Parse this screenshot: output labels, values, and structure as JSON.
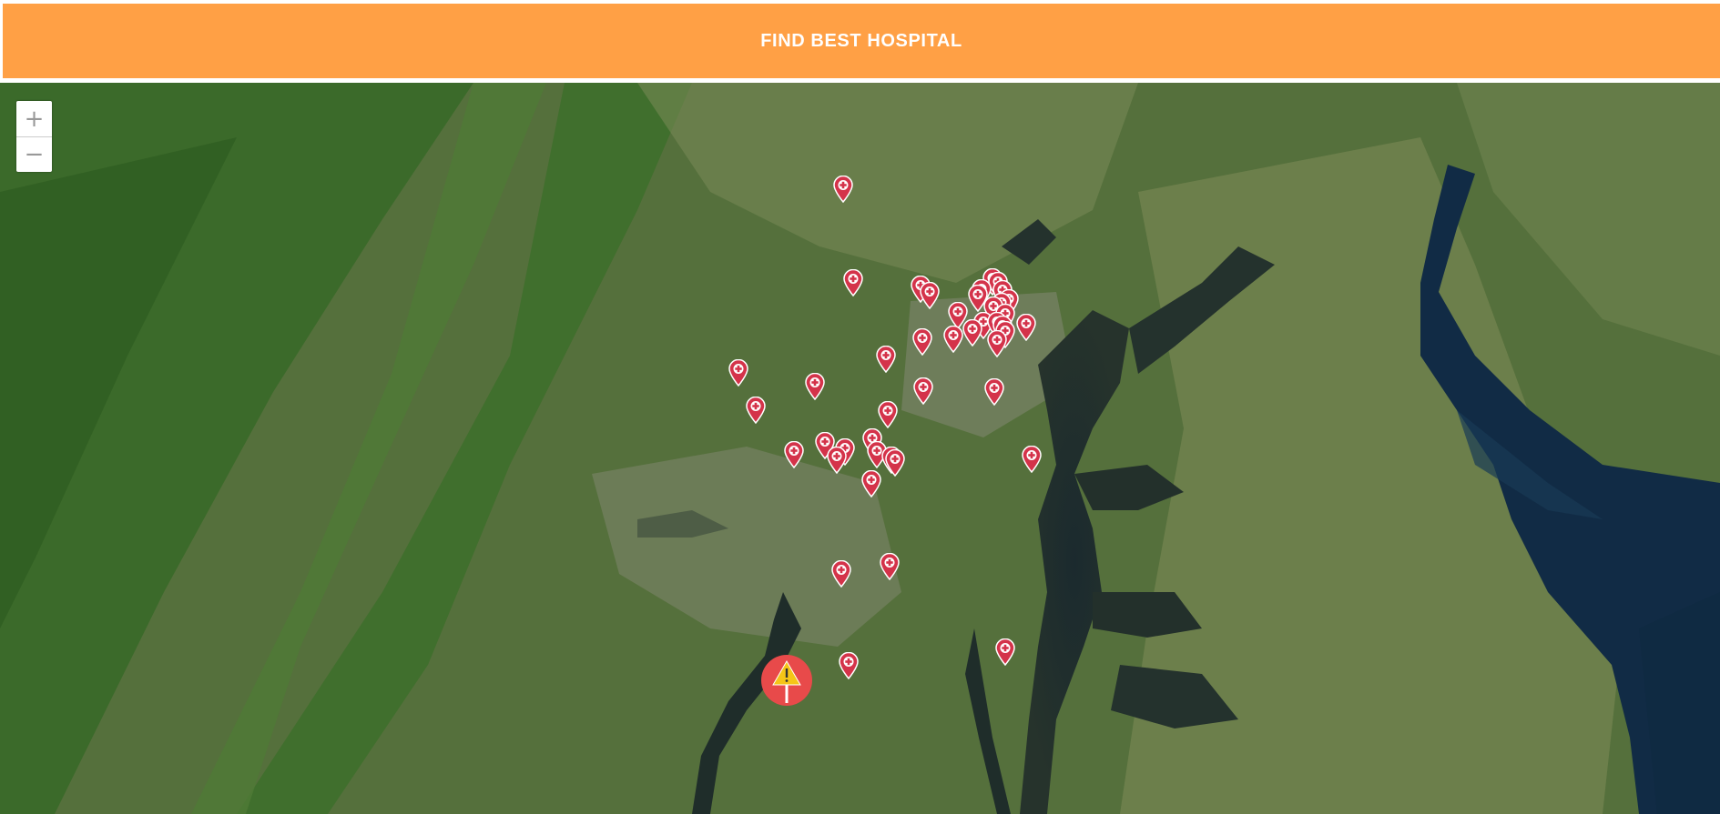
{
  "header": {
    "button_label": "FIND BEST HOSPITAL"
  },
  "map": {
    "basemap": "satellite imagery",
    "zoom_in_icon": "plus-icon",
    "zoom_out_icon": "minus-icon",
    "hospital_icon": "hospital-marker-icon",
    "alert_icon": "warning-sign-icon",
    "colors": {
      "marker": "#d4334a",
      "alert": "#e84a4a",
      "alert_sign": "#f5c518",
      "header": "#ffa045"
    }
  }
}
